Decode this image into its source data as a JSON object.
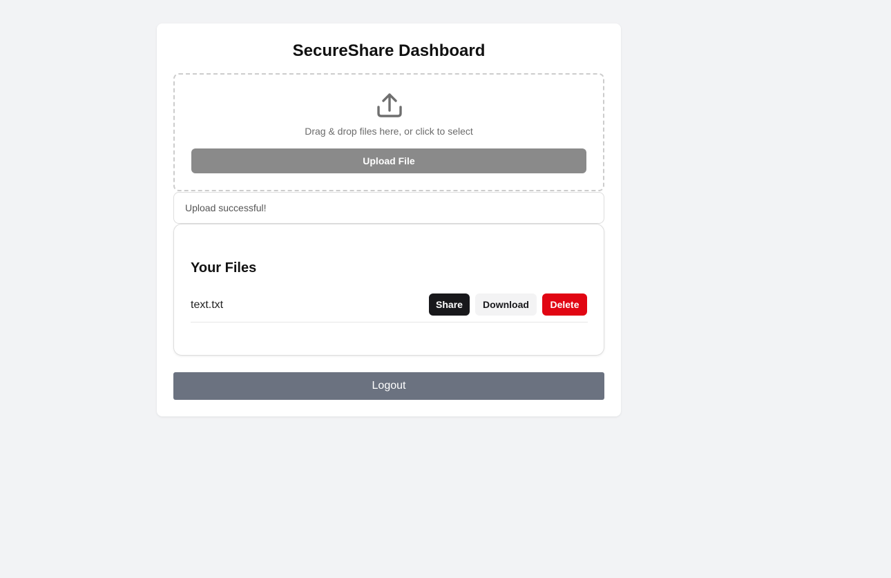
{
  "dashboard": {
    "title": "SecureShare Dashboard"
  },
  "upload": {
    "icon": "upload-icon",
    "hint": "Drag & drop files here, or click to select",
    "button_label": "Upload File"
  },
  "status": {
    "message": "Upload successful!"
  },
  "files": {
    "heading": "Your Files",
    "items": [
      {
        "name": "text.txt",
        "share_label": "Share",
        "download_label": "Download",
        "delete_label": "Delete"
      }
    ]
  },
  "logout": {
    "label": "Logout"
  },
  "colors": {
    "background": "#f2f3f5",
    "upload_button": "#8a8a8a",
    "share_button": "#18181b",
    "download_button": "#f3f3f4",
    "delete_button": "#e10613",
    "logout_button": "#6b7280"
  }
}
